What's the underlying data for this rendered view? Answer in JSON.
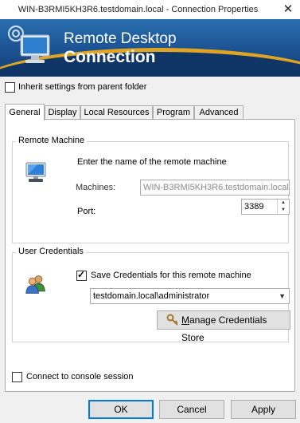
{
  "window": {
    "title": "WIN-B3RMI5KH3R6.testdomain.local - Connection Properties",
    "close_glyph": "✕"
  },
  "banner": {
    "line1": "Remote Desktop",
    "line2": "Connection",
    "accent_color": "#e0a424",
    "logo_icon": "remote-desktop-logo-icon"
  },
  "inherit": {
    "label": "Inherit settings from parent folder",
    "checked": false
  },
  "tabs": [
    {
      "label": "General",
      "active": true
    },
    {
      "label": "Display",
      "active": false
    },
    {
      "label": "Local Resources",
      "active": false
    },
    {
      "label": "Program",
      "active": false
    },
    {
      "label": "Advanced",
      "active": false
    }
  ],
  "remote_machine": {
    "group_title": "Remote Machine",
    "instruction": "Enter the name of the remote machine",
    "machines_label": "Machines:",
    "machines_value": "WIN-B3RMI5KH3R6.testdomain.local",
    "port_label": "Port:",
    "port_value": "3389",
    "icon": "computer-icon"
  },
  "user_credentials": {
    "group_title": "User Credentials",
    "save_label": "Save Credentials for this remote machine",
    "save_checked": true,
    "credential_selected": "testdomain.local\\administrator",
    "manage_button_prefix": "M",
    "manage_button_rest": "anage Credentials Store",
    "icon": "users-icon"
  },
  "console": {
    "label": "Connect to console session",
    "checked": false
  },
  "footer": {
    "ok": "OK",
    "cancel": "Cancel",
    "apply": "Apply"
  }
}
